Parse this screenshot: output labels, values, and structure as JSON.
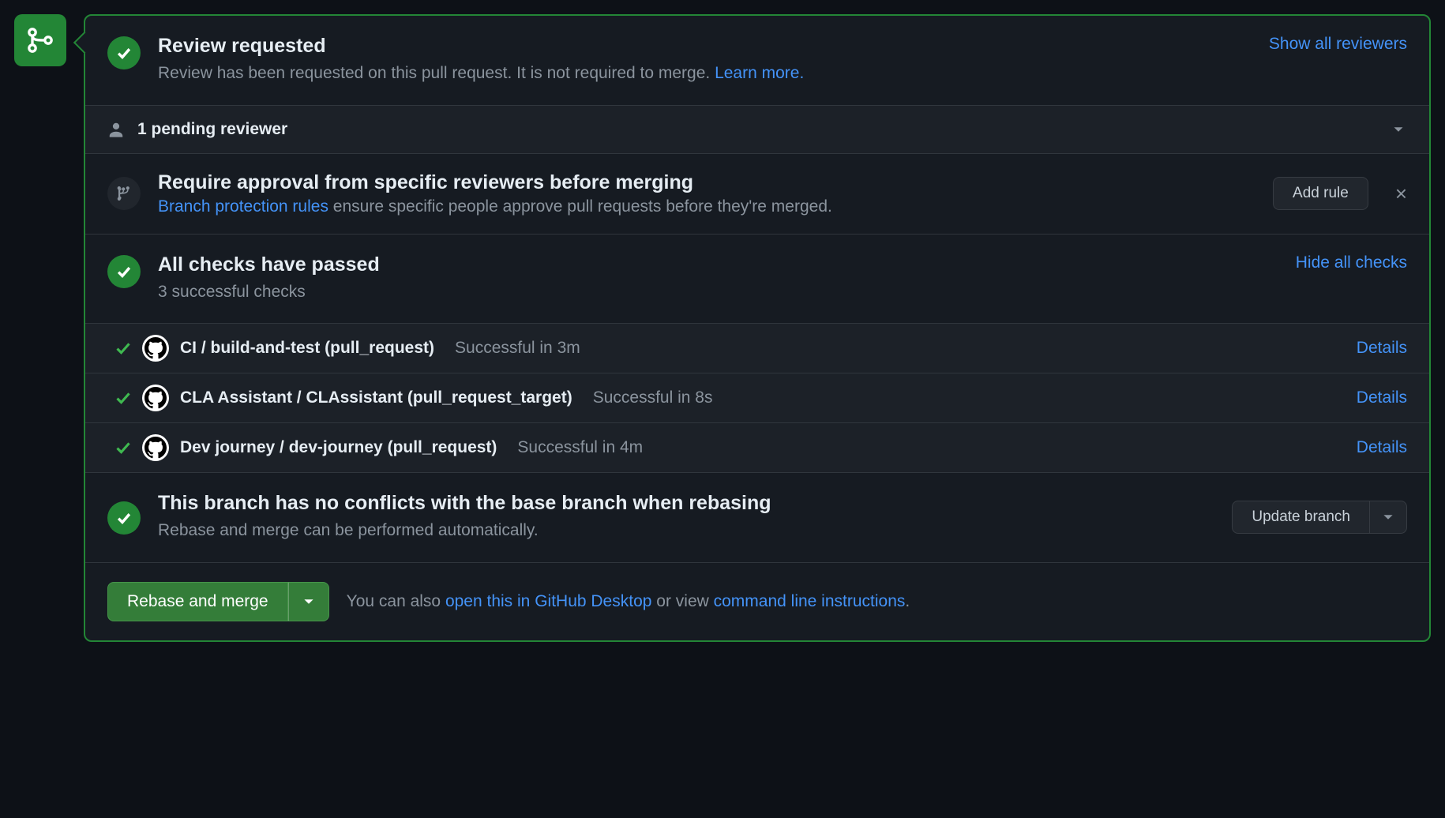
{
  "review": {
    "title": "Review requested",
    "subtitle_pre": "Review has been requested on this pull request. It is not required to merge. ",
    "learn_more": "Learn more.",
    "show_all": "Show all reviewers"
  },
  "pending": {
    "label": "1 pending reviewer"
  },
  "rule": {
    "title": "Require approval from specific reviewers before merging",
    "link": "Branch protection rules",
    "suffix": " ensure specific people approve pull requests before they're merged.",
    "add_rule": "Add rule"
  },
  "checks": {
    "title": "All checks have passed",
    "subtitle": "3 successful checks",
    "hide_all": "Hide all checks",
    "details_label": "Details",
    "items": [
      {
        "name": "CI / build-and-test (pull_request)",
        "status": "Successful in 3m"
      },
      {
        "name": "CLA Assistant / CLAssistant (pull_request_target)",
        "status": "Successful in 8s"
      },
      {
        "name": "Dev journey / dev-journey (pull_request)",
        "status": "Successful in 4m"
      }
    ]
  },
  "conflicts": {
    "title": "This branch has no conflicts with the base branch when rebasing",
    "subtitle": "Rebase and merge can be performed automatically.",
    "update_branch": "Update branch"
  },
  "merge": {
    "button": "Rebase and merge",
    "note_pre": "You can also ",
    "open_desktop": "open this in GitHub Desktop",
    "note_mid": " or view ",
    "cli": "command line instructions",
    "note_post": "."
  }
}
